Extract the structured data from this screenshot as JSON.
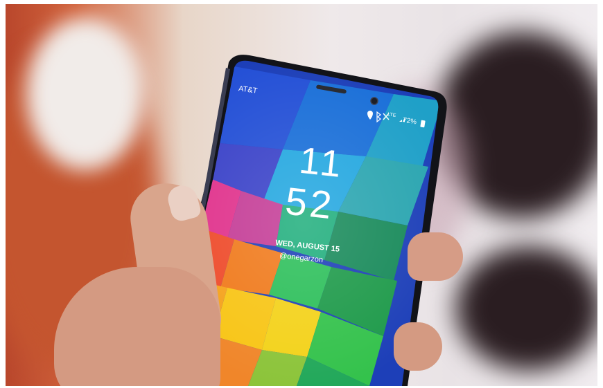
{
  "status_bar": {
    "carrier": "AT&T",
    "network": "LTE",
    "battery": "72%"
  },
  "lock_screen": {
    "hour": "11",
    "minute": "52",
    "date": "WED, AUGUST 15",
    "owner": "@onegarzon"
  },
  "icons": [
    "location-icon",
    "bluetooth-icon",
    "mute-icon",
    "signal-icon",
    "battery-icon"
  ],
  "colors": {
    "phone_body": "#111216",
    "clock_text": "#ffffff",
    "background_orange": "#c95a35",
    "background_dark": "#241a1e"
  }
}
